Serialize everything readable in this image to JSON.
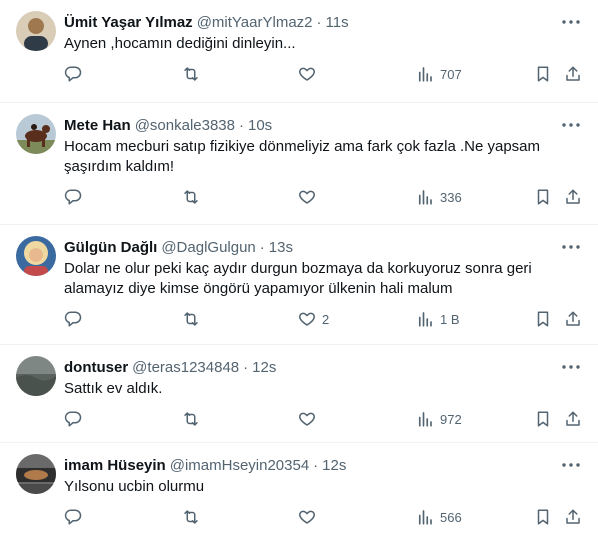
{
  "tweets": [
    {
      "name": "Ümit Yaşar Yılmaz",
      "handle": "@mitYaarYlmaz2",
      "dot": "·",
      "time": "11s",
      "text": "Aynen ,hocamın dediğini dinleyin...",
      "like_count": "",
      "views": "707",
      "avatar_colors": [
        "#c9b8a0",
        "#7a5a3a"
      ]
    },
    {
      "name": "Mete Han",
      "handle": "@sonkale3838",
      "dot": "·",
      "time": "10s",
      "text": "Hocam mecburi satıp fizikiye dönmeliyiz ama fark çok fazla .Ne yapsam şaşırdım kaldım!",
      "like_count": "",
      "views": "336",
      "avatar_colors": [
        "#9fb6c9",
        "#5a2e1c"
      ]
    },
    {
      "name": "Gülgün Dağlı",
      "handle": "@DaglGulgun",
      "dot": "·",
      "time": "13s",
      "text": "Dolar ne olur peki kaç aydır durgun bozmaya da korkuyoruz sonra geri alamayız diye kimse öngörü yapamıyor ülkenin hali malum",
      "like_count": "2",
      "views": "1 B",
      "avatar_colors": [
        "#3b6aa0",
        "#e8c78a"
      ]
    },
    {
      "name": "dontuser",
      "handle": "@teras1234848",
      "dot": "·",
      "time": "12s",
      "text": "Sattık ev aldık.",
      "like_count": "",
      "views": "972",
      "avatar_colors": [
        "#8a8f8c",
        "#4c5650"
      ]
    },
    {
      "name": "imam Hüseyin",
      "handle": "@imamHseyin20354",
      "dot": "·",
      "time": "12s",
      "text": "Yılsonu ucbin olurmu",
      "like_count": "",
      "views": "566",
      "avatar_colors": [
        "#3a3a3a",
        "#b07a4a"
      ]
    }
  ],
  "icons": {
    "reply": "reply-icon",
    "retweet": "retweet-icon",
    "like": "heart-icon",
    "views": "views-icon",
    "bookmark": "bookmark-icon",
    "share": "share-icon",
    "more": "more-icon"
  },
  "colors": {
    "text": "#0f1419",
    "muted": "#536471",
    "divider": "#eff3f4"
  }
}
